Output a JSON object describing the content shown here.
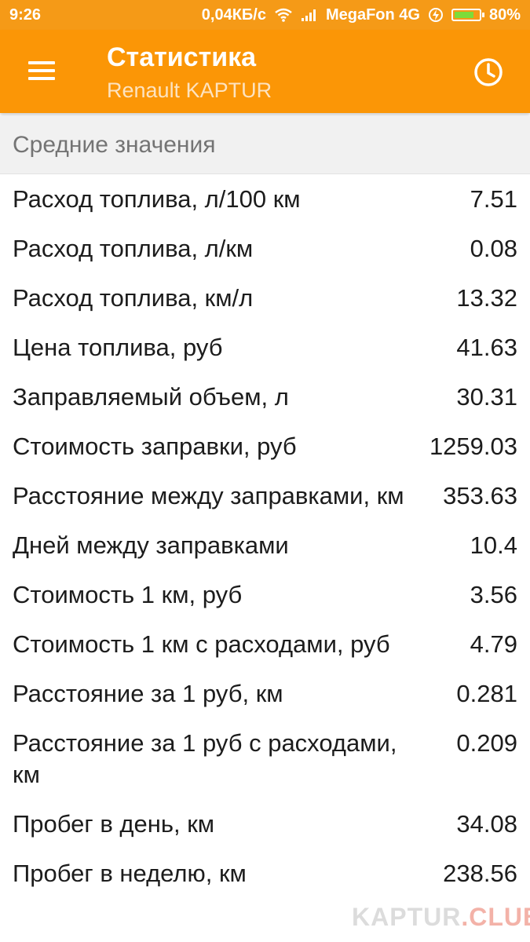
{
  "statusbar": {
    "time": "9:26",
    "speed": "0,04КБ/с",
    "carrier": "MegaFon 4G",
    "battery": "80%",
    "battery_level": 0.8
  },
  "toolbar": {
    "title": "Статистика",
    "subtitle": "Renault KAPTUR"
  },
  "section": {
    "title": "Средние значения"
  },
  "rows": [
    {
      "label": "Расход топлива, л/100 км",
      "value": "7.51"
    },
    {
      "label": "Расход топлива, л/км",
      "value": "0.08"
    },
    {
      "label": "Расход топлива, км/л",
      "value": "13.32"
    },
    {
      "label": "Цена топлива, руб",
      "value": "41.63"
    },
    {
      "label": "Заправляемый объем, л",
      "value": "30.31"
    },
    {
      "label": "Стоимость заправки, руб",
      "value": "1259.03"
    },
    {
      "label": "Расстояние между заправками, км",
      "value": "353.63"
    },
    {
      "label": "Дней между заправками",
      "value": "10.4"
    },
    {
      "label": "Стоимость 1 км, руб",
      "value": "3.56"
    },
    {
      "label": "Стоимость 1 км с расходами, руб",
      "value": "4.79"
    },
    {
      "label": "Расстояние за 1 руб, км",
      "value": "0.281"
    },
    {
      "label": "Расстояние за 1 руб с расходами, км",
      "value": "0.209"
    },
    {
      "label": "Пробег в день, км",
      "value": "34.08"
    },
    {
      "label": "Пробег в неделю, км",
      "value": "238.56"
    }
  ],
  "watermark": {
    "main": "KAPTUR",
    "accent": ".CLUB"
  },
  "colors": {
    "accent": "#fb9606",
    "statusbar": "#f59a17"
  }
}
